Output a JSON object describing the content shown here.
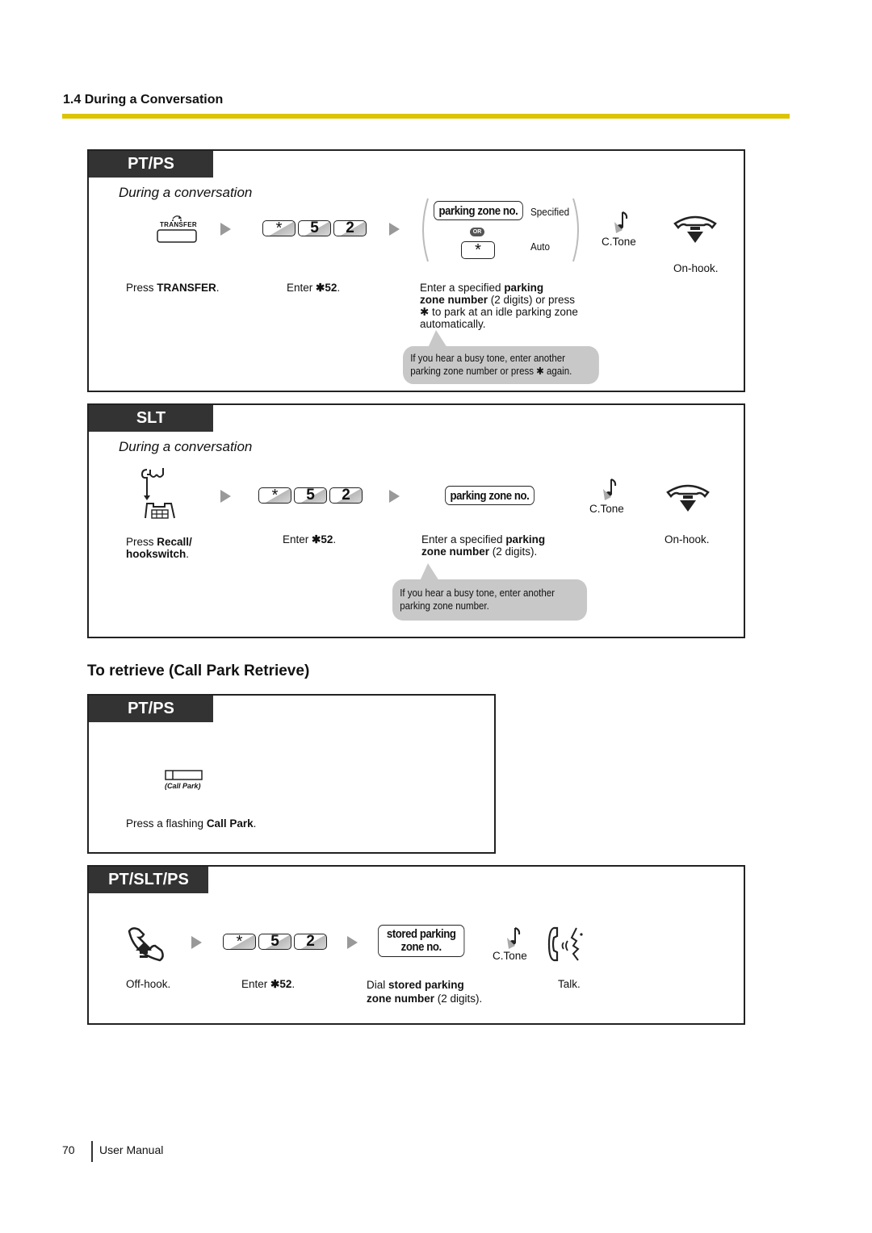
{
  "header": {
    "section_title": "1.4 During a Conversation",
    "rule_color": "#dcc400"
  },
  "ptps_park": {
    "tab": "PT/PS",
    "subtitle": "During a conversation",
    "transfer_key_label": "TRANSFER",
    "keys": [
      "*",
      "5",
      "2"
    ],
    "zone_pill": "parking zone no.",
    "specified_label": "Specified",
    "or_label": "OR",
    "auto_key": "*",
    "auto_label": "Auto",
    "ctone": "C.Tone",
    "steps": {
      "step1_pre": "Press ",
      "step1_bold": "TRANSFER",
      "step1_post": ".",
      "step2_pre": "Enter ",
      "step2_bold": "✱52",
      "step2_post": ".",
      "step3_line1_pre": "Enter a specified ",
      "step3_line1_bold": "parking",
      "step3_line2_bold": "zone number",
      "step3_line2_post": " (2 digits) or press",
      "step3_line3": "✱ to park at an idle parking zone",
      "step3_line4": "automatically.",
      "step4": "On-hook."
    },
    "bubble_line1": "If you hear a busy tone, enter another",
    "bubble_line2": "parking zone number or press ✱ again."
  },
  "slt_park": {
    "tab": "SLT",
    "subtitle": "During a conversation",
    "keys": [
      "*",
      "5",
      "2"
    ],
    "zone_pill": "parking zone no.",
    "ctone": "C.Tone",
    "steps": {
      "step1_pre": "Press ",
      "step1_bold_line1": "Recall/",
      "step1_bold_line2": "hookswitch",
      "step1_post": ".",
      "step2_pre": "Enter ",
      "step2_bold": "✱52",
      "step2_post": ".",
      "step3_line1_pre": "Enter a specified ",
      "step3_line1_bold": "parking",
      "step3_line2_bold": "zone number",
      "step3_line2_post": " (2 digits).",
      "step4": "On-hook."
    },
    "bubble_line1": "If you hear a busy tone, enter another",
    "bubble_line2": "parking zone number."
  },
  "retrieve": {
    "heading": "To retrieve (Call Park Retrieve)",
    "ptps": {
      "tab": "PT/PS",
      "callpark_key_label": "(Call Park)",
      "step_pre": "Press a flashing ",
      "step_bold": "Call Park",
      "step_post": "."
    },
    "ptsltps": {
      "tab": "PT/SLT/PS",
      "keys": [
        "*",
        "5",
        "2"
      ],
      "stored_pill_line1": "stored parking",
      "stored_pill_line2": "zone no.",
      "ctone": "C.Tone",
      "steps": {
        "step1": "Off-hook.",
        "step2_pre": "Enter ",
        "step2_bold": "✱52",
        "step2_post": ".",
        "step3_line1_pre": "Dial ",
        "step3_line1_bold": "stored parking",
        "step3_line2_bold": "zone number",
        "step3_line2_post": " (2 digits).",
        "step4": "Talk."
      }
    }
  },
  "footer": {
    "page_number": "70",
    "doc_title": "User Manual"
  }
}
